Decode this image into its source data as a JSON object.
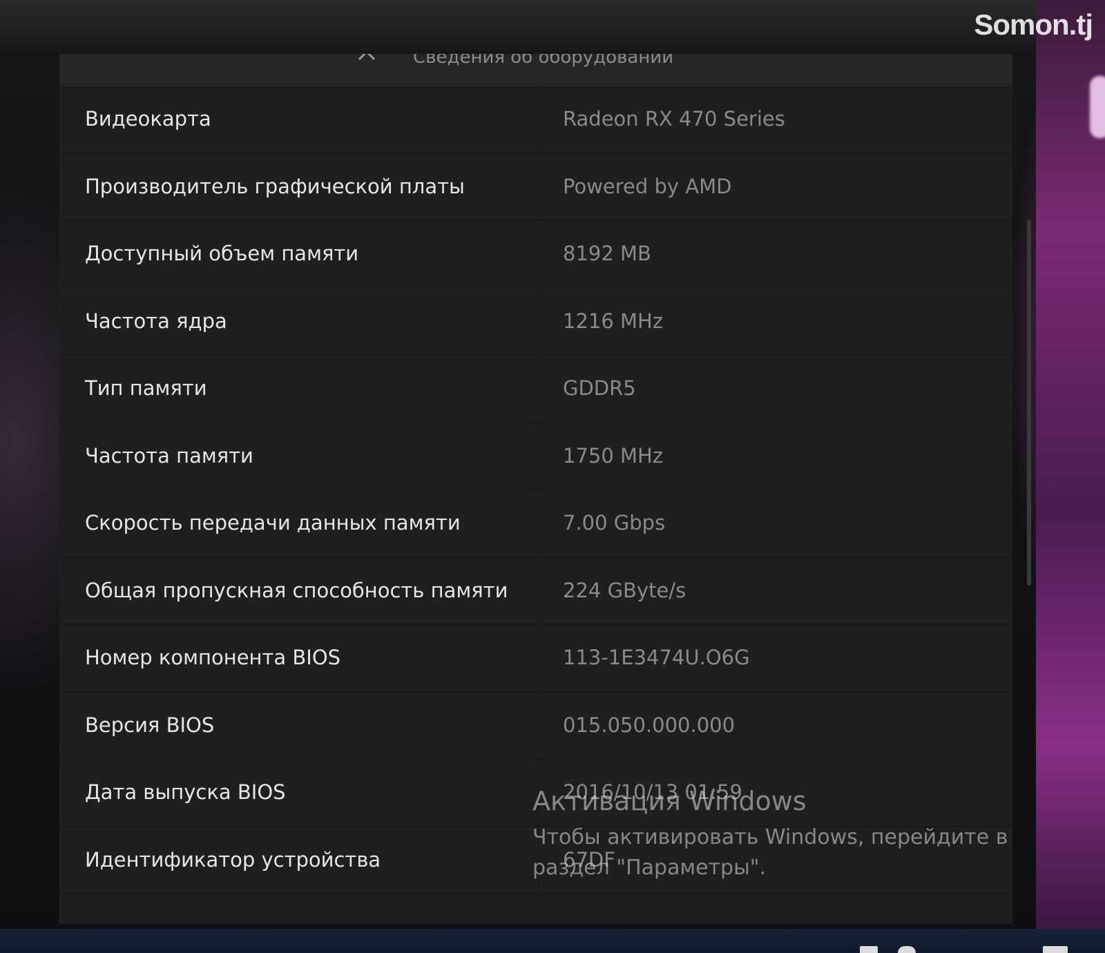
{
  "watermark": "Somon.tj",
  "panel": {
    "title": "Сведения об оборудовании",
    "collapse_icon": "chevron-up-icon"
  },
  "rows": [
    {
      "label": "Видеокарта",
      "value": "Radeon RX 470 Series"
    },
    {
      "label": "Производитель графической платы",
      "value": "Powered by AMD"
    },
    {
      "label": "Доступный объем памяти",
      "value": "8192 MB"
    },
    {
      "label": "Частота ядра",
      "value": "1216 MHz"
    },
    {
      "label": "Тип памяти",
      "value": "GDDR5"
    },
    {
      "label": "Частота памяти",
      "value": "1750 MHz"
    },
    {
      "label": "Скорость передачи данных памяти",
      "value": "7.00 Gbps"
    },
    {
      "label": "Общая пропускная способность памяти",
      "value": "224 GByte/s"
    },
    {
      "label": "Номер компонента BIOS",
      "value": "113-1E3474U.O6G"
    },
    {
      "label": "Версия BIOS",
      "value": "015.050.000.000"
    },
    {
      "label": "Дата выпуска BIOS",
      "value": "2016/10/13 01:59"
    },
    {
      "label": "Идентификатор устройства",
      "value": "67DF"
    },
    {
      "label": "",
      "value": ""
    }
  ],
  "activation": {
    "title": "Активация Windows",
    "text": "Чтобы активировать Windows, перейдите в раздел \"Параметры\"."
  }
}
